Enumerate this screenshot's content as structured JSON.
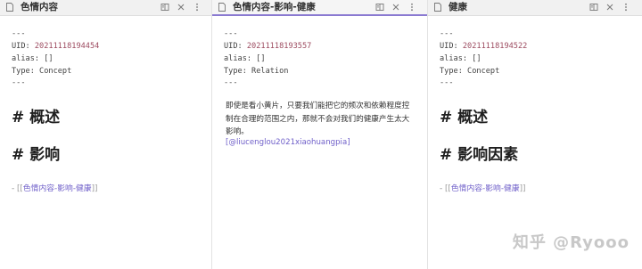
{
  "panes": [
    {
      "title": "色情内容",
      "frontmatter": {
        "sep_open": "---",
        "uid_label": "UID: ",
        "uid_value": "20211118194454",
        "alias": "alias: []",
        "type": "Type: Concept",
        "sep_close": "---"
      },
      "headings": [
        "# 概述",
        "# 影响"
      ],
      "link": {
        "dash": "- ",
        "open": "[[",
        "text": "色情内容-影响-健康",
        "close": "]]"
      }
    },
    {
      "title": "色情内容-影响-健康",
      "active": true,
      "frontmatter": {
        "sep_open": "---",
        "uid_label": "UID: ",
        "uid_value": "20211118193557",
        "alias": "alias: []",
        "type": "Type: Relation",
        "sep_close": "---"
      },
      "paragraph": "即使是看小黄片，只要我们能把它的频次和依赖程度控制在合理的范围之内，那就不会对我们的健康产生太大影响。",
      "citation": "[@liucenglou2021xiaohuangpia]"
    },
    {
      "title": "健康",
      "frontmatter": {
        "sep_open": "---",
        "uid_label": "UID: ",
        "uid_value": "20211118194522",
        "alias": "alias: []",
        "type": "Type: Concept",
        "sep_close": "---"
      },
      "headings": [
        "# 概述",
        "# 影响因素"
      ],
      "link": {
        "dash": "- ",
        "open": "[[",
        "text": "色情内容-影响-健康",
        "close": "]]"
      }
    }
  ],
  "header_icons": [
    "reading-view-icon",
    "close-icon",
    "more-options-icon"
  ],
  "watermark": "知乎 @Ryooo",
  "colors": {
    "accent": "#6f5fc9",
    "active_tab_border": "#8a7ad1",
    "uid_value": "#9c4a5f",
    "header_bg": "#f1f1f1"
  }
}
